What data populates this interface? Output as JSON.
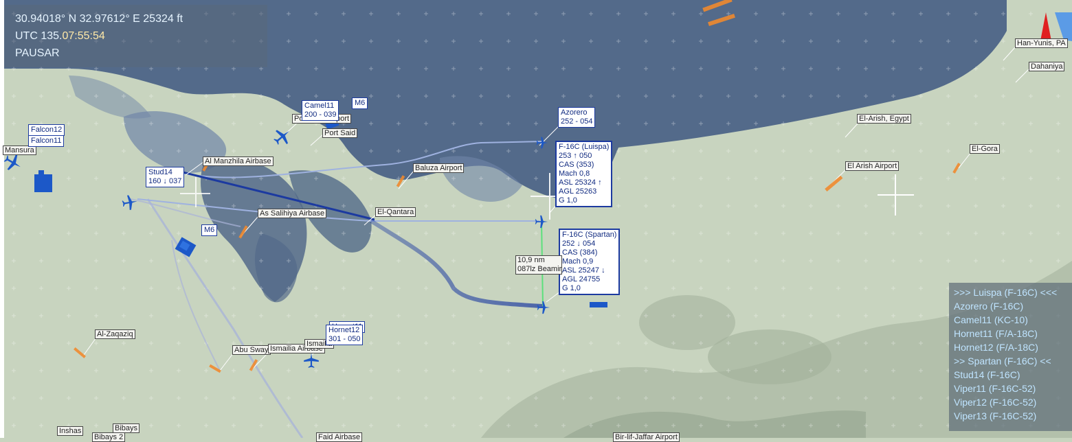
{
  "hud": {
    "coords": "30.94018° N  32.97612° E  25324 ft",
    "utc_prefix": "UTC 135.",
    "utc_time": "07:55:54",
    "status": "PAUSAR"
  },
  "colors": {
    "sea": "#536a8a",
    "land": "#c8d4bf",
    "track_blue": "#1c3aa0",
    "route_line": "#9fb2e0",
    "text_cyan": "#bfe4ff"
  },
  "places": [
    {
      "name": "Mansura"
    },
    {
      "name": "Port Said Airport"
    },
    {
      "name": "Port Said"
    },
    {
      "name": "Al Manzhila Airbase"
    },
    {
      "name": "Baluza Airport"
    },
    {
      "name": "As Salihiya Airbase"
    },
    {
      "name": "El-Qantara"
    },
    {
      "name": "El-Arish, Egypt"
    },
    {
      "name": "El Arish Airport"
    },
    {
      "name": "El-Gora"
    },
    {
      "name": "Han-Yunis, PA"
    },
    {
      "name": "Dahaniya"
    },
    {
      "name": "Al-Zaqaziq"
    },
    {
      "name": "Abu Sway"
    },
    {
      "name": "Ismailia Airbase"
    },
    {
      "name": "Ismailia"
    },
    {
      "name": "Inshas"
    },
    {
      "name": "Bibays"
    },
    {
      "name": "Bibays 2"
    },
    {
      "name": "Faid Airbase"
    },
    {
      "name": "Bir-lif-Jaffar Airport"
    }
  ],
  "units": {
    "camel11": {
      "name": "Camel11",
      "info": "200 - 039"
    },
    "m6_top": {
      "name": "M6"
    },
    "m6_left": {
      "name": "M6"
    },
    "falcon12": {
      "name": "Falcon12"
    },
    "falcon11": {
      "name": "Falcon11"
    },
    "stud14": {
      "name": "Stud14",
      "info": "160 ↓ 037"
    },
    "azorero": {
      "name": "Azorero",
      "info": "252 - 054"
    },
    "hornet11": {
      "name": "Hornet11"
    },
    "hornet12": {
      "name": "Hornet12",
      "info": "301 - 050"
    }
  },
  "luispa": {
    "title": "F-16C (Luispa)",
    "heading": "253 ↑ 050",
    "cas": "CAS (353)",
    "mach": "Mach 0,8",
    "asl": "ASL 25324 ↑",
    "agl": "AGL 25263",
    "g": "G 1,0"
  },
  "spartan": {
    "title": "F-16C (Spartan)",
    "heading": "252 ↓ 054",
    "cas": "CAS (384)",
    "mach": "Mach 0,9",
    "asl": "ASL 25247 ↓",
    "agl": "AGL 24755",
    "g": "G 1,0"
  },
  "measure": {
    "distance": "10,9 nm",
    "bearing": "087lz Beamir"
  },
  "unit_list": [
    ">>> Luispa (F-16C) <<<",
    "Azorero (F-16C)",
    "Camel11 (KC-10)",
    "Hornet11 (F/A-18C)",
    "Hornet12 (F/A-18C)",
    ">> Spartan (F-16C) <<",
    "Stud14 (F-16C)",
    "Viper11 (F-16C-52)",
    "Viper12 (F-16C-52)",
    "Viper13 (F-16C-52)"
  ]
}
